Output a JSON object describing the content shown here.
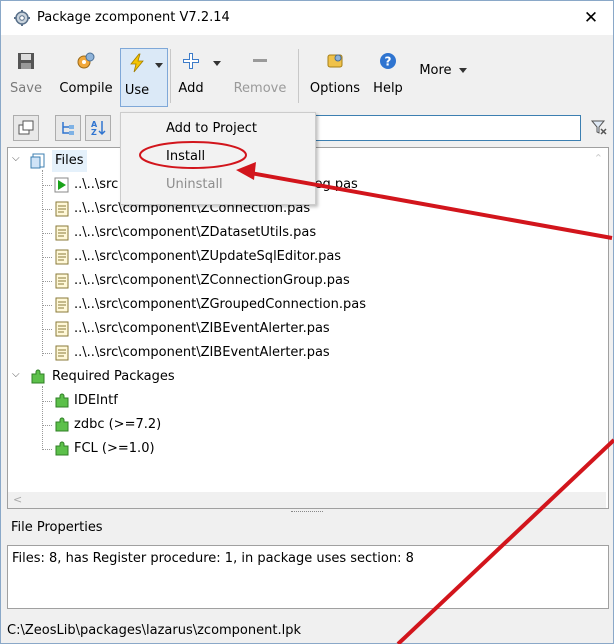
{
  "window": {
    "title": "Package zcomponent V7.2.14",
    "close_glyph": "✕"
  },
  "toolbar": {
    "save": "Save",
    "compile": "Compile",
    "use": "Use",
    "add": "Add",
    "remove": "Remove",
    "options": "Options",
    "help": "Help",
    "more": "More"
  },
  "menu": {
    "items": [
      "Add to Project",
      "Install",
      "Uninstall"
    ]
  },
  "tree": {
    "files_label": "Files",
    "files": [
      "..\\..\\src",
      "..\\..\\src\\component\\ZConnection.pas",
      "..\\..\\src\\component\\ZDatasetUtils.pas",
      "..\\..\\src\\component\\ZUpdateSqlEditor.pas",
      "..\\..\\src\\component\\ZConnectionGroup.pas",
      "..\\..\\src\\component\\ZGroupedConnection.pas",
      "..\\..\\src\\component\\ZIBEventAlerter.pas",
      "..\\..\\src\\component\\ZIBEventAlerter.pas"
    ],
    "file_partial_right": "Reg.pas",
    "required_label": "Required Packages",
    "packages": [
      "IDEIntf",
      "zdbc (>=7.2)",
      "FCL (>=1.0)"
    ]
  },
  "file_properties": {
    "title": "File Properties",
    "text": "Files: 8, has Register procedure: 1, in package uses section: 8"
  },
  "status": {
    "path": "C:\\ZeosLib\\packages\\lazarus\\zcomponent.lpk"
  },
  "colors": {
    "accent": "#3c7fb1",
    "annotation": "#d2151c"
  }
}
